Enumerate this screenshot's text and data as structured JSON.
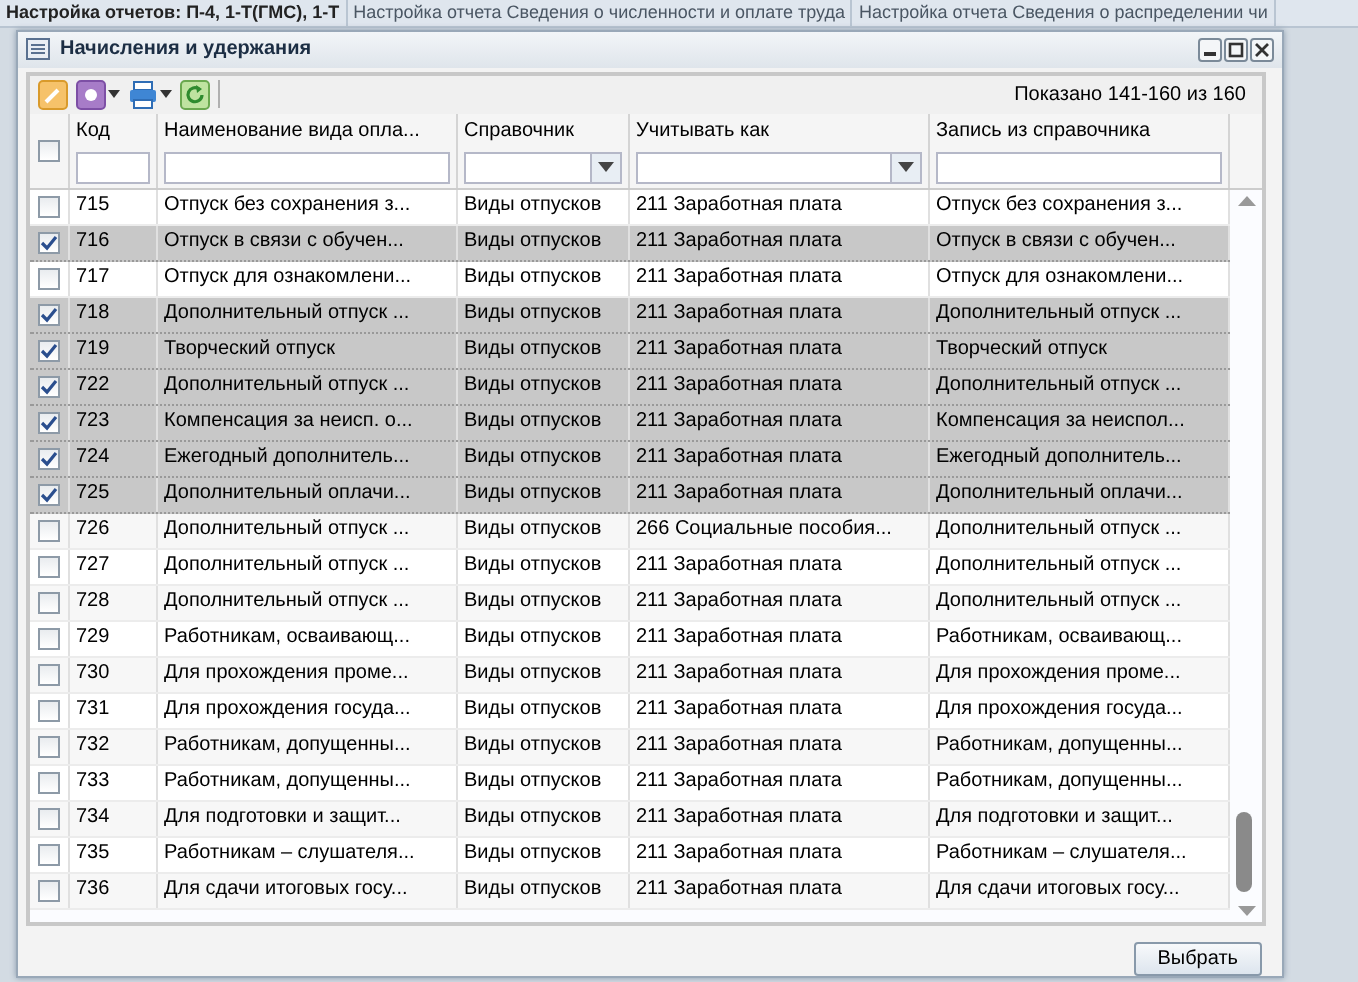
{
  "background_tabs": [
    {
      "label": "Настройка отчетов: П-4, 1-Т(ГМС), 1-Т",
      "selected": true
    },
    {
      "label": "Настройка отчета  Сведения о численности и оплате труда",
      "selected": false
    },
    {
      "label": "Настройка отчета  Сведения о распределении чи",
      "selected": false
    }
  ],
  "window": {
    "title": "Начисления и удержания"
  },
  "toolbar": {
    "paging": "Показано 141-160 из 160"
  },
  "table": {
    "all_checked": false,
    "columns": [
      {
        "label": "Код",
        "kind": "text"
      },
      {
        "label": "Наименование вида опла...",
        "kind": "text"
      },
      {
        "label": "Справочник",
        "kind": "combo"
      },
      {
        "label": "Учитывать как",
        "kind": "combo"
      },
      {
        "label": "Запись из справочника",
        "kind": "text"
      }
    ],
    "rows": [
      {
        "code": "715",
        "name": "Отпуск без сохранения з...",
        "directory": "Виды отпусков",
        "account": "211 Заработная плата",
        "record": "Отпуск без сохранения з...",
        "selected": false
      },
      {
        "code": "716",
        "name": "Отпуск в связи с обучен...",
        "directory": "Виды отпусков",
        "account": "211 Заработная плата",
        "record": "Отпуск в связи с обучен...",
        "selected": true
      },
      {
        "code": "717",
        "name": "Отпуск для ознакомлени...",
        "directory": "Виды отпусков",
        "account": "211 Заработная плата",
        "record": "Отпуск для ознакомлени...",
        "selected": false
      },
      {
        "code": "718",
        "name": "Дополнительный отпуск ...",
        "directory": "Виды отпусков",
        "account": "211 Заработная плата",
        "record": "Дополнительный отпуск ...",
        "selected": true
      },
      {
        "code": "719",
        "name": "Творческий отпуск",
        "directory": "Виды отпусков",
        "account": "211 Заработная плата",
        "record": "Творческий отпуск",
        "selected": true
      },
      {
        "code": "722",
        "name": "Дополнительный отпуск ...",
        "directory": "Виды отпусков",
        "account": "211 Заработная плата",
        "record": "Дополнительный отпуск ...",
        "selected": true
      },
      {
        "code": "723",
        "name": "Компенсация за неисп. о...",
        "directory": "Виды отпусков",
        "account": "211 Заработная плата",
        "record": "Компенсация за неиспол...",
        "selected": true
      },
      {
        "code": "724",
        "name": "Ежегодный дополнитель...",
        "directory": "Виды отпусков",
        "account": "211 Заработная плата",
        "record": "Ежегодный дополнитель...",
        "selected": true
      },
      {
        "code": "725",
        "name": "Дополнительный оплачи...",
        "directory": "Виды отпусков",
        "account": "211 Заработная плата",
        "record": "Дополнительный оплачи...",
        "selected": true
      },
      {
        "code": "726",
        "name": "Дополнительный отпуск ...",
        "directory": "Виды отпусков",
        "account": "266 Социальные пособия...",
        "record": "Дополнительный отпуск ...",
        "selected": false
      },
      {
        "code": "727",
        "name": "Дополнительный отпуск ...",
        "directory": "Виды отпусков",
        "account": "211 Заработная плата",
        "record": "Дополнительный отпуск ...",
        "selected": false
      },
      {
        "code": "728",
        "name": "Дополнительный отпуск ...",
        "directory": "Виды отпусков",
        "account": "211 Заработная плата",
        "record": "Дополнительный отпуск ...",
        "selected": false
      },
      {
        "code": "729",
        "name": "Работникам, осваивающ...",
        "directory": "Виды отпусков",
        "account": "211 Заработная плата",
        "record": "Работникам, осваивающ...",
        "selected": false
      },
      {
        "code": "730",
        "name": "Для прохождения проме...",
        "directory": "Виды отпусков",
        "account": "211 Заработная плата",
        "record": "Для прохождения проме...",
        "selected": false
      },
      {
        "code": "731",
        "name": "Для прохождения госуда...",
        "directory": "Виды отпусков",
        "account": "211 Заработная плата",
        "record": "Для прохождения госуда...",
        "selected": false
      },
      {
        "code": "732",
        "name": "Работникам, допущенны...",
        "directory": "Виды отпусков",
        "account": "211 Заработная плата",
        "record": "Работникам, допущенны...",
        "selected": false
      },
      {
        "code": "733",
        "name": "Работникам, допущенны...",
        "directory": "Виды отпусков",
        "account": "211 Заработная плата",
        "record": "Работникам, допущенны...",
        "selected": false
      },
      {
        "code": "734",
        "name": "Для подготовки и защит...",
        "directory": "Виды отпусков",
        "account": "211 Заработная плата",
        "record": "Для подготовки и защит...",
        "selected": false
      },
      {
        "code": "735",
        "name": "Работникам – слушателя...",
        "directory": "Виды отпусков",
        "account": "211 Заработная плата",
        "record": "Работникам – слушателя...",
        "selected": false
      },
      {
        "code": "736",
        "name": "Для сдачи итоговых госу...",
        "directory": "Виды отпусков",
        "account": "211 Заработная плата",
        "record": "Для сдачи итоговых госу...",
        "selected": false
      }
    ]
  },
  "buttons": [
    {
      "label": "Выбрать"
    }
  ]
}
